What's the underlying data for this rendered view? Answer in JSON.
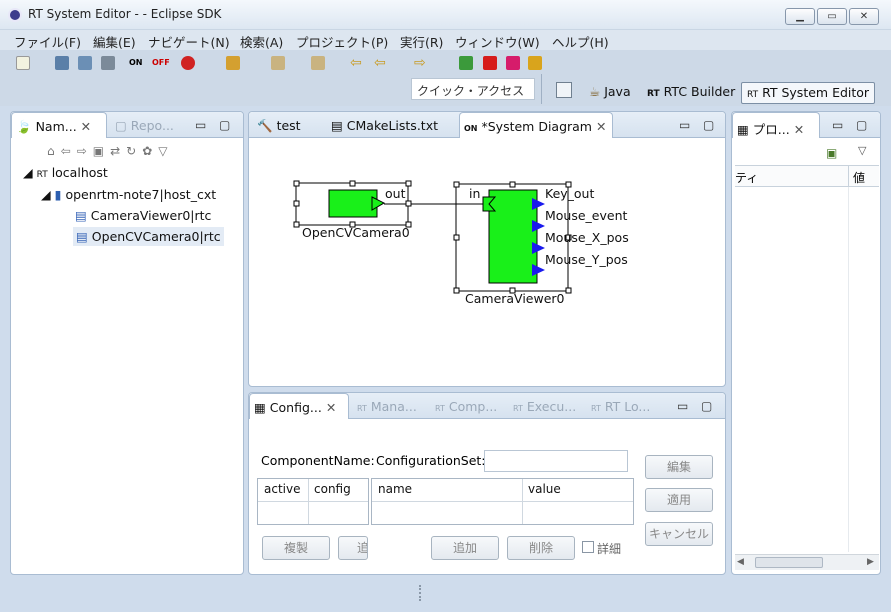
{
  "window": {
    "title": "RT System Editor -  - Eclipse SDK"
  },
  "menu": [
    "ファイル(F)",
    "編集(E)",
    "ナビゲート(N)",
    "検索(A)",
    "プロジェクト(P)",
    "実行(R)",
    "ウィンドウ(W)",
    "ヘルプ(H)"
  ],
  "quick_access": {
    "placeholder": "クイック・アクセス"
  },
  "perspectives": {
    "java": "Java",
    "rtc_builder": "RTC Builder",
    "rt_system_editor": "RT System Editor"
  },
  "left_panel": {
    "tabs": [
      "Nam...",
      "Repo..."
    ],
    "tree": {
      "root": "localhost",
      "child": "openrtm-note7|host_cxt",
      "items": [
        "CameraViewer0|rtc",
        "OpenCVCamera0|rtc"
      ]
    }
  },
  "editor": {
    "tabs": [
      "test",
      "CMakeLists.txt",
      "*System Diagram"
    ],
    "diagram": {
      "opencv": {
        "name": "OpenCVCamera0",
        "port": "out"
      },
      "viewer": {
        "name": "CameraViewer0",
        "in_port": "in",
        "out_ports": [
          "Key_out",
          "Mouse_event",
          "Mouse_X_pos",
          "Mouse_Y_pos"
        ]
      }
    }
  },
  "bottom_panel": {
    "tabs": [
      "Config...",
      "Mana...",
      "Comp...",
      "Execu...",
      "RT Lo..."
    ],
    "component_name_label": "ComponentName:",
    "configuration_set_label": "ConfigurationSet:",
    "left_grid_headers": [
      "active",
      "config"
    ],
    "right_grid_headers": [
      "name",
      "value"
    ],
    "buttons": {
      "copy": "複製",
      "add_left": "追",
      "add": "追加",
      "delete": "削除",
      "detail": "詳細",
      "edit": "編集",
      "apply": "適用",
      "cancel": "キャンセル"
    }
  },
  "right_panel": {
    "tab": "プロ...",
    "headers": [
      "ティ",
      "値"
    ]
  }
}
